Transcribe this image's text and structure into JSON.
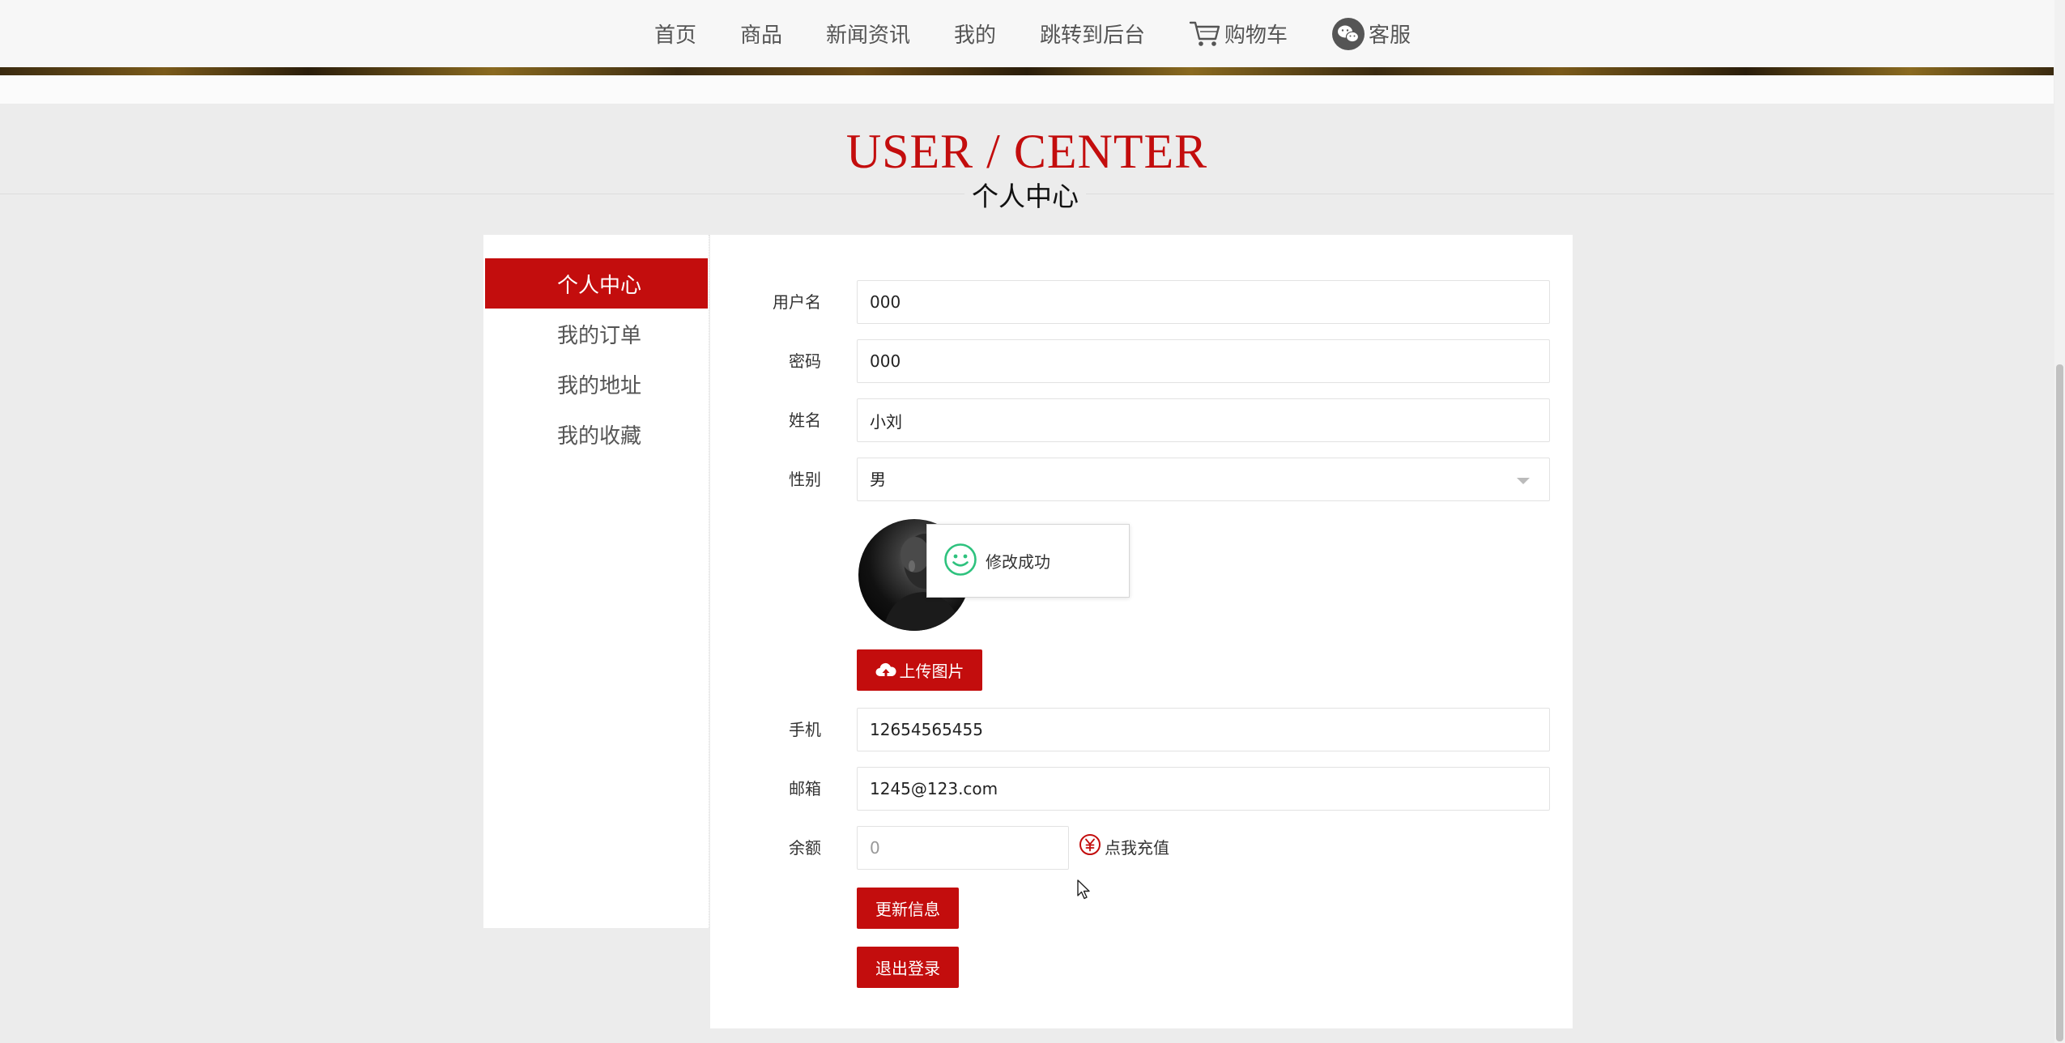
{
  "nav": {
    "items": [
      {
        "label": "首页"
      },
      {
        "label": "商品"
      },
      {
        "label": "新闻资讯"
      },
      {
        "label": "我的"
      },
      {
        "label": "跳转到后台"
      },
      {
        "label": "购物车",
        "icon": "cart-icon"
      },
      {
        "label": "客服",
        "icon": "wechat-icon"
      }
    ]
  },
  "page": {
    "title": "USER / CENTER",
    "subtitle": "个人中心"
  },
  "sidebar": {
    "items": [
      {
        "label": "个人中心",
        "active": true
      },
      {
        "label": "我的订单"
      },
      {
        "label": "我的地址"
      },
      {
        "label": "我的收藏"
      }
    ]
  },
  "form": {
    "username": {
      "label": "用户名",
      "value": "000"
    },
    "password": {
      "label": "密码",
      "value": "000"
    },
    "name": {
      "label": "姓名",
      "value": "小刘"
    },
    "gender": {
      "label": "性别",
      "value": "男"
    },
    "phone": {
      "label": "手机",
      "value": "12654565455"
    },
    "email": {
      "label": "邮箱",
      "value": "1245@123.com"
    },
    "balance": {
      "label": "余额",
      "value": "0"
    },
    "upload_label": "上传图片",
    "recharge_label": "点我充值",
    "update_label": "更新信息",
    "logout_label": "退出登录"
  },
  "toast": {
    "message": "修改成功",
    "icon": "smile-icon"
  },
  "colors": {
    "accent": "#c30d0d",
    "toast_icon": "#2ec27e",
    "background": "#ececec"
  }
}
